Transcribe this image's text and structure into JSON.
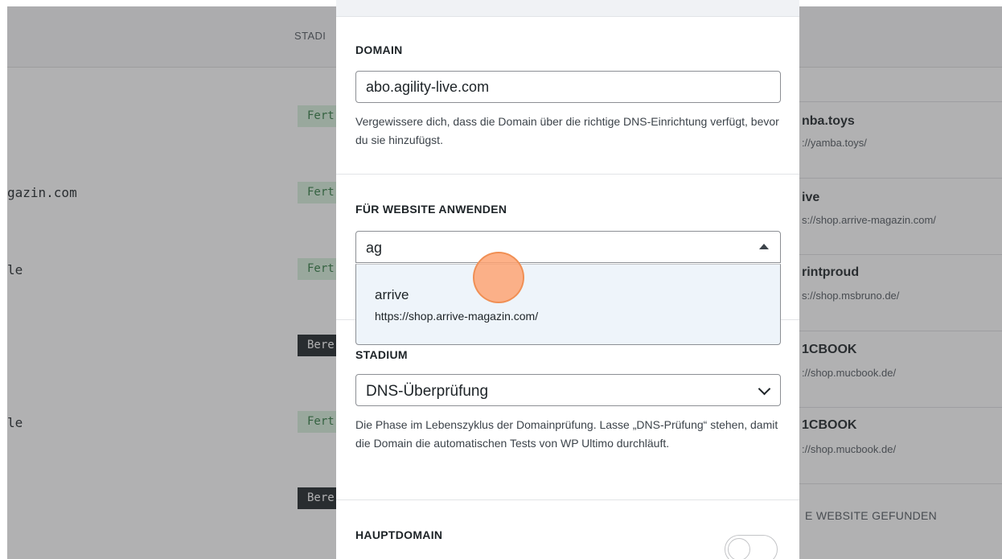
{
  "background": {
    "column_header": "STADI",
    "left_cells": [
      "gazin.com",
      "le",
      "le"
    ],
    "badges": [
      {
        "label": "Fert",
        "type": "done"
      },
      {
        "label": "Fert",
        "type": "done"
      },
      {
        "label": "Fert",
        "type": "done"
      },
      {
        "label": "Bere",
        "type": "ready"
      },
      {
        "label": "Fert",
        "type": "done"
      },
      {
        "label": "Bere",
        "type": "ready"
      }
    ],
    "sites": [
      {
        "title": "nba.toys",
        "url": "://yamba.toys/"
      },
      {
        "title": "ive",
        "url": "s://shop.arrive-magazin.com/"
      },
      {
        "title": "rintproud",
        "url": "s://shop.msbruno.de/"
      },
      {
        "title": "1CBOOK",
        "url": "://shop.mucbook.de/"
      },
      {
        "title": "1CBOOK",
        "url": "://shop.mucbook.de/"
      }
    ],
    "none_found": "E WEBSITE GEFUNDEN"
  },
  "modal": {
    "domain": {
      "label": "DOMAIN",
      "value": "abo.agility-live.com",
      "help": "Vergewissere dich, dass die Domain über die richtige DNS-Einrichtung verfügt, bevor du sie hinzufügst."
    },
    "site": {
      "label": "FÜR WEBSITE ANWENDEN",
      "search_value": "ag",
      "options": [
        {
          "title": "arrive",
          "url": "https://shop.arrive-magazin.com/"
        }
      ]
    },
    "stage": {
      "label": "STADIUM",
      "selected": "DNS-Überprüfung",
      "help": "Die Phase im Lebenszyklus der Domainprüfung. Lasse „DNS-Prüfung“ stehen, damit die Domain die automatischen Tests von WP Ultimo durchläuft."
    },
    "primary": {
      "label": "HAUPTDOMAIN",
      "enabled": false
    }
  },
  "colors": {
    "overlay": "#3c3c3e",
    "dropdown_bg": "#eef4fa",
    "cursor": "#fda373",
    "badge_done_bg": "#d7f0dd",
    "badge_ready_bg": "#1d2327"
  }
}
